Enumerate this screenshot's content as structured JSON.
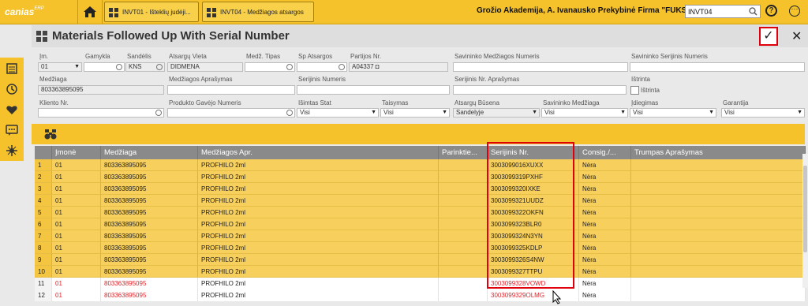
{
  "topbar": {
    "logo": "canias",
    "logo_sup": "ERP",
    "tabs": [
      {
        "label": "INVT01 - Išteklių judėji..."
      },
      {
        "label": "INVT04 - Medžiagos atsargos"
      }
    ],
    "company": "Grožio Akademija, A. Ivanausko Prekybinė Firma \"FUKS\"",
    "search_value": "INVT04"
  },
  "window": {
    "title": "Materials Followed Up With Serial Number",
    "ok_label": "✓",
    "close_label": "✕"
  },
  "form": {
    "imone_label": "Įm.",
    "imone_value": "01",
    "gamykla_label": "Gamykla",
    "sandelis_label": "Sandėlis",
    "sandelis_value": "KNS",
    "atsargu_vieta_label": "Atsargų Vieta",
    "atsargu_vieta_value": "DIDMENA",
    "medz_tipas_label": "Medž. Tipas",
    "sp_atsargos_label": "Sp Atsargos",
    "partijos_label": "Partijos Nr.",
    "partijos_value": "A04337 ◘",
    "sav_medz_nr_label": "Savininko Medžiagos Numeris",
    "sav_serij_nr_label": "Savininko Serijinis Numeris",
    "medziaga_label": "Medžiaga",
    "medziaga_value": "803363895095",
    "medz_apr_label": "Medžiagos Aprašymas",
    "serij_nr_label": "Serijinis Numeris",
    "serij_apr_label": "Serijinis Nr. Aprašymas",
    "istrinta_label": "Ištrinta",
    "istrinta_chk_label": "Ištrinta",
    "kliento_label": "Kliento Nr.",
    "produkto_label": "Produkto Gavėjo Numeris",
    "isimtas_label": "Išimtas Stat",
    "isimtas_value": "Visi",
    "taisymas_label": "Taisymas",
    "taisymas_value": "Visi",
    "atsargu_busena_label": "Atsargų Būsena",
    "atsargu_busena_value": "Sandelyje",
    "sav_medziaga_label": "Savininko Medžiaga",
    "sav_medziaga_value": "Visi",
    "idiegimas_label": "Įdiegimas",
    "idiegimas_value": "Visi",
    "garantija_label": "Garantija",
    "garantija_value": "Visi"
  },
  "grid": {
    "headers": [
      "",
      "Įmonė",
      "Medžiaga",
      "Medžiagos Apr.",
      "Parinktie...",
      "Serijinis Nr.",
      "Consig./...",
      "Trumpas Aprašymas"
    ],
    "rows": [
      {
        "n": "1",
        "imone": "01",
        "medziaga": "803363895095",
        "apr": "PROFHILO 2ml",
        "serial": "3003099016XUXX",
        "consig": "Nėra",
        "selected": true
      },
      {
        "n": "2",
        "imone": "01",
        "medziaga": "803363895095",
        "apr": "PROFHILO 2ml",
        "serial": "3003099319PXHF",
        "consig": "Nėra",
        "selected": true
      },
      {
        "n": "3",
        "imone": "01",
        "medziaga": "803363895095",
        "apr": "PROFHILO 2ml",
        "serial": "3003099320IXKE",
        "consig": "Nėra",
        "selected": true
      },
      {
        "n": "4",
        "imone": "01",
        "medziaga": "803363895095",
        "apr": "PROFHILO 2ml",
        "serial": "3003099321UUDZ",
        "consig": "Nėra",
        "selected": true
      },
      {
        "n": "5",
        "imone": "01",
        "medziaga": "803363895095",
        "apr": "PROFHILO 2ml",
        "serial": "3003099322OKFN",
        "consig": "Nėra",
        "selected": true
      },
      {
        "n": "6",
        "imone": "01",
        "medziaga": "803363895095",
        "apr": "PROFHILO 2ml",
        "serial": "3003099323BLR0",
        "consig": "Nėra",
        "selected": true
      },
      {
        "n": "7",
        "imone": "01",
        "medziaga": "803363895095",
        "apr": "PROFHILO 2ml",
        "serial": "3003099324N3YN",
        "consig": "Nėra",
        "selected": true
      },
      {
        "n": "8",
        "imone": "01",
        "medziaga": "803363895095",
        "apr": "PROFHILO 2ml",
        "serial": "3003099325KDLP",
        "consig": "Nėra",
        "selected": true
      },
      {
        "n": "9",
        "imone": "01",
        "medziaga": "803363895095",
        "apr": "PROFHILO 2ml",
        "serial": "3003099326S4NW",
        "consig": "Nėra",
        "selected": true
      },
      {
        "n": "10",
        "imone": "01",
        "medziaga": "803363895095",
        "apr": "PROFHILO 2ml",
        "serial": "3003099327TTPU",
        "consig": "Nėra",
        "selected": true
      },
      {
        "n": "11",
        "imone": "01",
        "medziaga": "803363895095",
        "apr": "PROFHILO 2ml",
        "serial": "3003099328VOWD",
        "consig": "Nėra",
        "selected": false
      },
      {
        "n": "12",
        "imone": "01",
        "medziaga": "803363895095",
        "apr": "PROFHILO 2ml",
        "serial": "3003099329OLMG",
        "consig": "Nėra",
        "selected": false
      }
    ]
  },
  "colors": {
    "accent": "#f5c22b",
    "highlight": "#e0000b",
    "row_selected": "#f7cf5d"
  }
}
